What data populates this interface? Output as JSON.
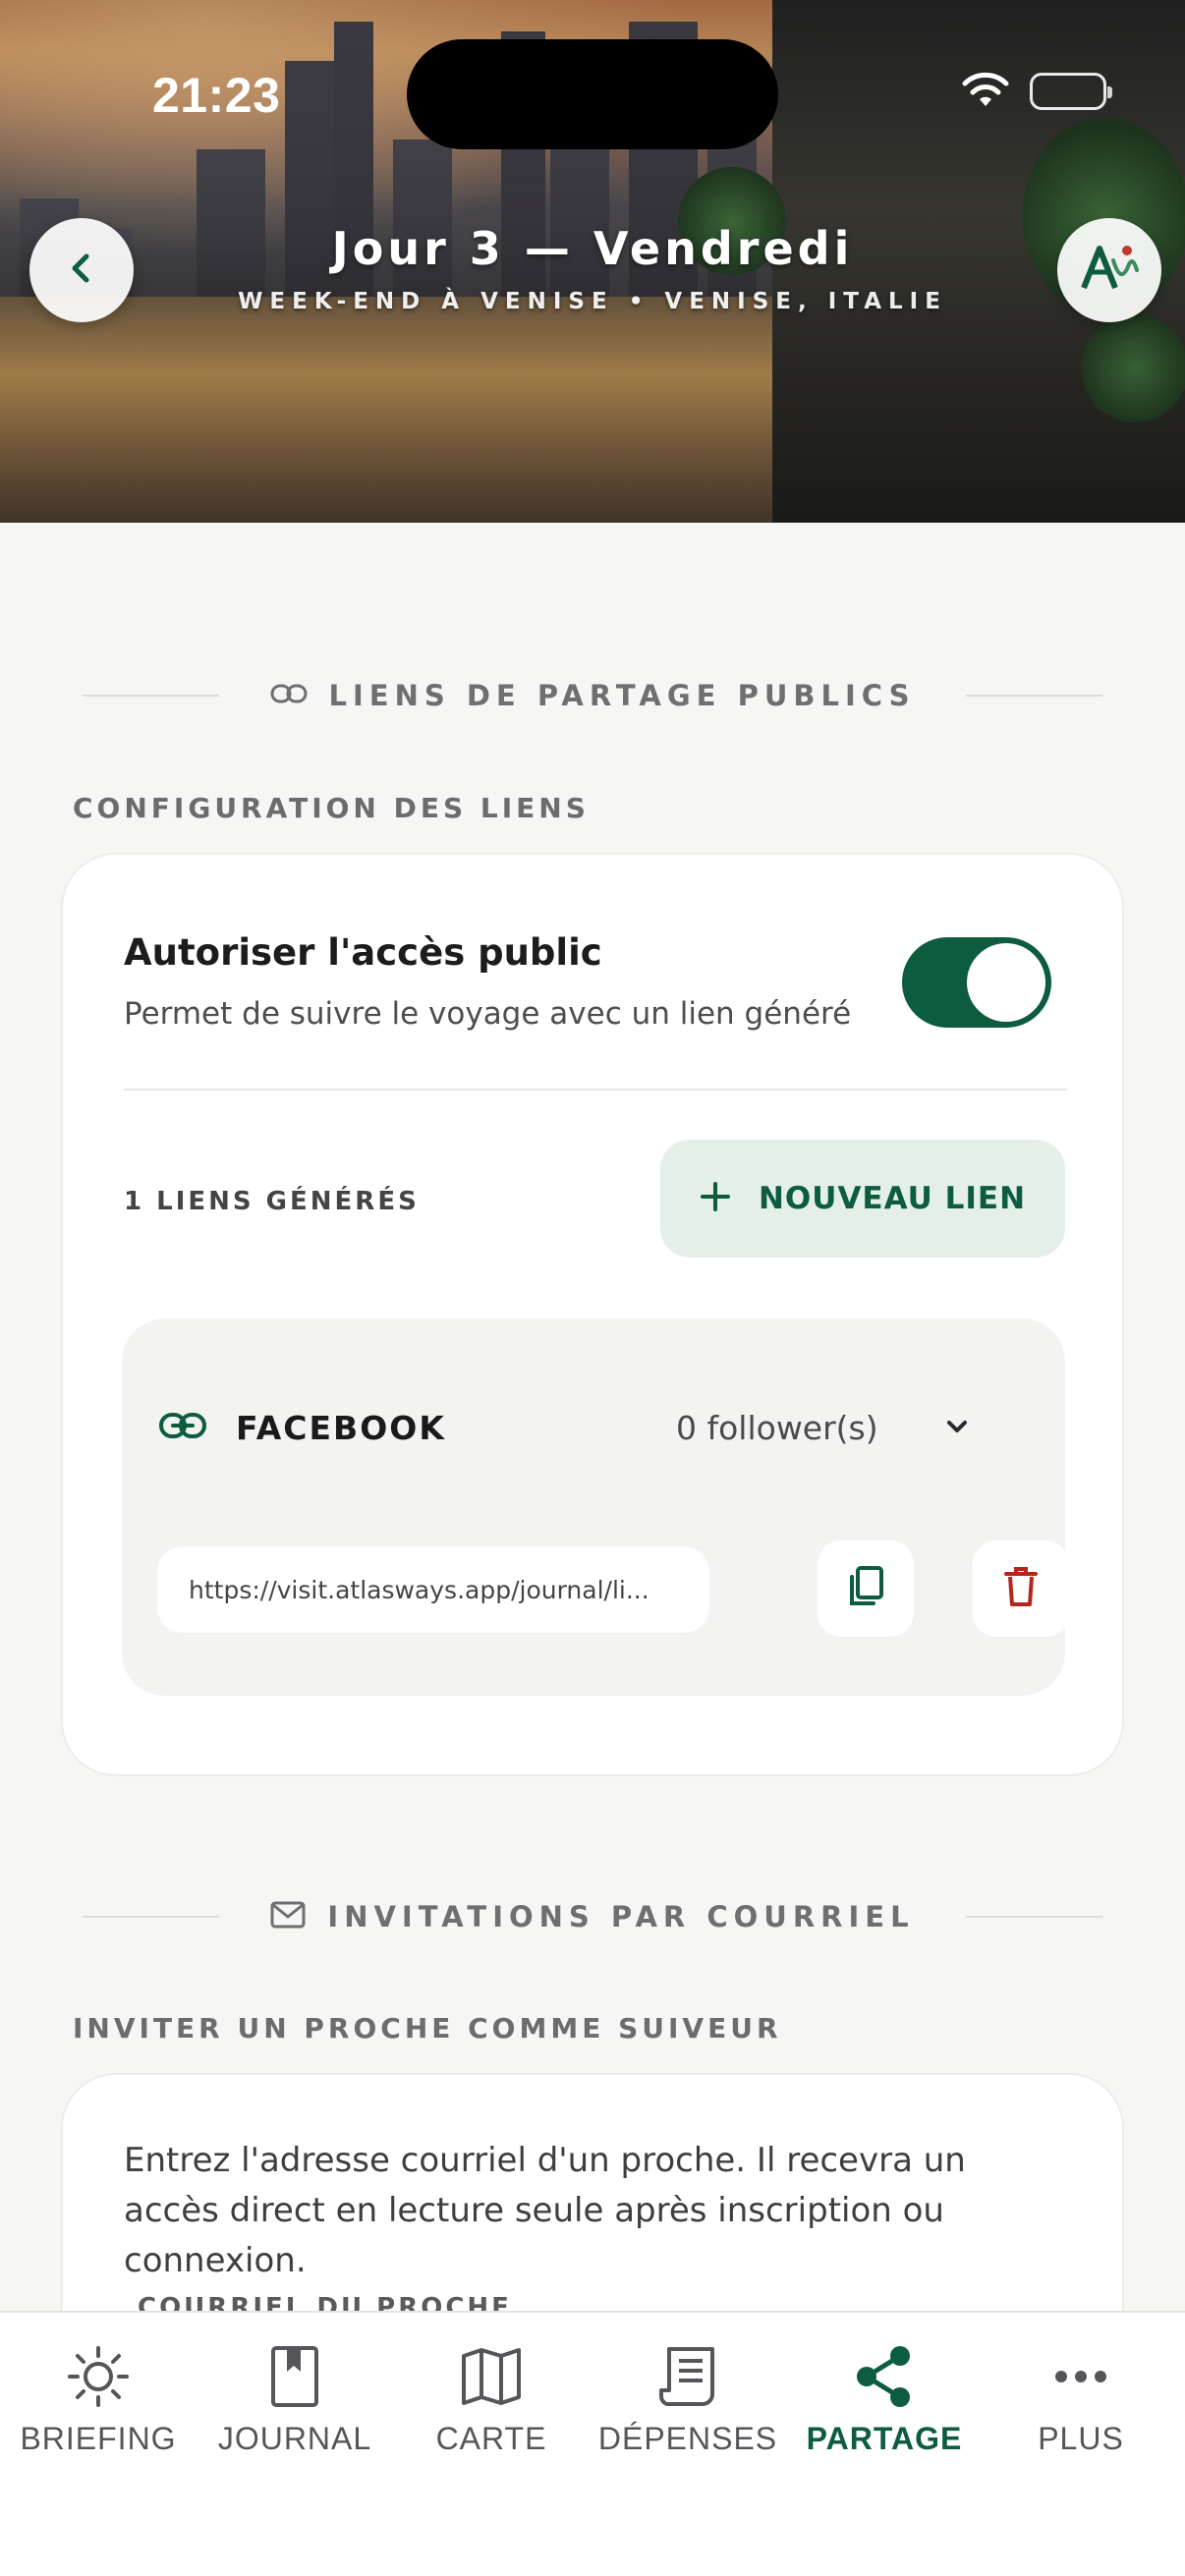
{
  "status_bar": {
    "time": "21:23"
  },
  "header": {
    "title": "Jour 3 — Vendredi",
    "subtitle": "WEEK-END À VENISE • VENISE, ITALIE"
  },
  "public_links": {
    "section_title": "LIENS DE PARTAGE PUBLICS",
    "config_heading": "CONFIGURATION DES LIENS",
    "toggle_title": "Autoriser l'accès public",
    "toggle_description": "Permet de suivre le voyage avec un lien généré",
    "toggle_on": true,
    "links_count": "1 LIENS GÉNÉRÉS",
    "new_link_label": "NOUVEAU LIEN",
    "links": [
      {
        "name": "FACEBOOK",
        "followers": "0 follower(s)",
        "url": "https://visit.atlasways.app/journal/li..."
      }
    ]
  },
  "email_invites": {
    "section_title": "INVITATIONS PAR COURRIEL",
    "heading": "INVITER UN PROCHE COMME SUIVEUR",
    "description": "Entrez l'adresse courriel d'un proche. Il recevra un accès direct en lecture seule après inscription ou connexion.",
    "field_label": "COURRIEL DU PROCHE"
  },
  "tabbar": {
    "items": [
      {
        "label": "BRIEFING",
        "icon": "sun-icon"
      },
      {
        "label": "JOURNAL",
        "icon": "book-icon"
      },
      {
        "label": "CARTE",
        "icon": "map-icon"
      },
      {
        "label": "DÉPENSES",
        "icon": "receipt-icon"
      },
      {
        "label": "PARTAGE",
        "icon": "share-icon",
        "active": true
      },
      {
        "label": "PLUS",
        "icon": "more-icon"
      }
    ]
  },
  "colors": {
    "accent": "#0d5c40",
    "danger": "#b3261e",
    "background": "#f6f6f5"
  }
}
